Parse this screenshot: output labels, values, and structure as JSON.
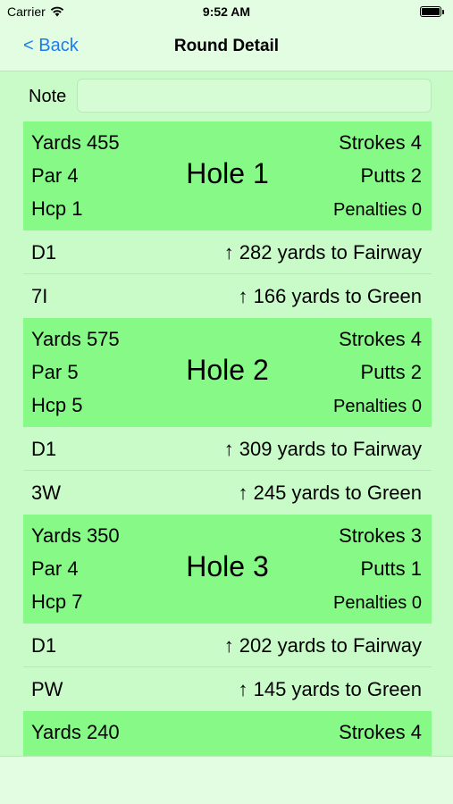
{
  "status_bar": {
    "carrier": "Carrier",
    "time": "9:52 AM"
  },
  "nav": {
    "back_label": "< Back",
    "title": "Round Detail"
  },
  "note": {
    "label": "Note",
    "value": ""
  },
  "holes": [
    {
      "yards": "Yards 455",
      "par": "Par  4",
      "hcp": "Hcp 1",
      "title": "Hole 1",
      "strokes": "Strokes 4",
      "putts": "Putts 2",
      "penalties": "Penalties 0",
      "shots": [
        {
          "club": "D1",
          "desc": "↑ 282 yards to Fairway"
        },
        {
          "club": "7I",
          "desc": "↑ 166 yards to Green"
        }
      ]
    },
    {
      "yards": "Yards 575",
      "par": "Par  5",
      "hcp": "Hcp 5",
      "title": "Hole 2",
      "strokes": "Strokes 4",
      "putts": "Putts 2",
      "penalties": "Penalties 0",
      "shots": [
        {
          "club": "D1",
          "desc": "↑ 309 yards to Fairway"
        },
        {
          "club": "3W",
          "desc": "↑ 245 yards to Green"
        }
      ]
    },
    {
      "yards": "Yards 350",
      "par": "Par  4",
      "hcp": "Hcp 7",
      "title": "Hole 3",
      "strokes": "Strokes 3",
      "putts": "Putts 1",
      "penalties": "Penalties 0",
      "shots": [
        {
          "club": "D1",
          "desc": "↑ 202 yards to Fairway"
        },
        {
          "club": "PW",
          "desc": "↑ 145 yards to Green"
        }
      ]
    },
    {
      "yards": "Yards 240",
      "par": "",
      "hcp": "",
      "title": "",
      "strokes": "Strokes 4",
      "putts": "",
      "penalties": "",
      "shots": []
    }
  ],
  "colors": {
    "background": "#c9fbc9",
    "bars": "#e2fde2",
    "hole_header": "#86f986",
    "link": "#1a7cf5"
  },
  "icons": {
    "wifi": "wifi-icon",
    "battery": "battery-icon"
  }
}
